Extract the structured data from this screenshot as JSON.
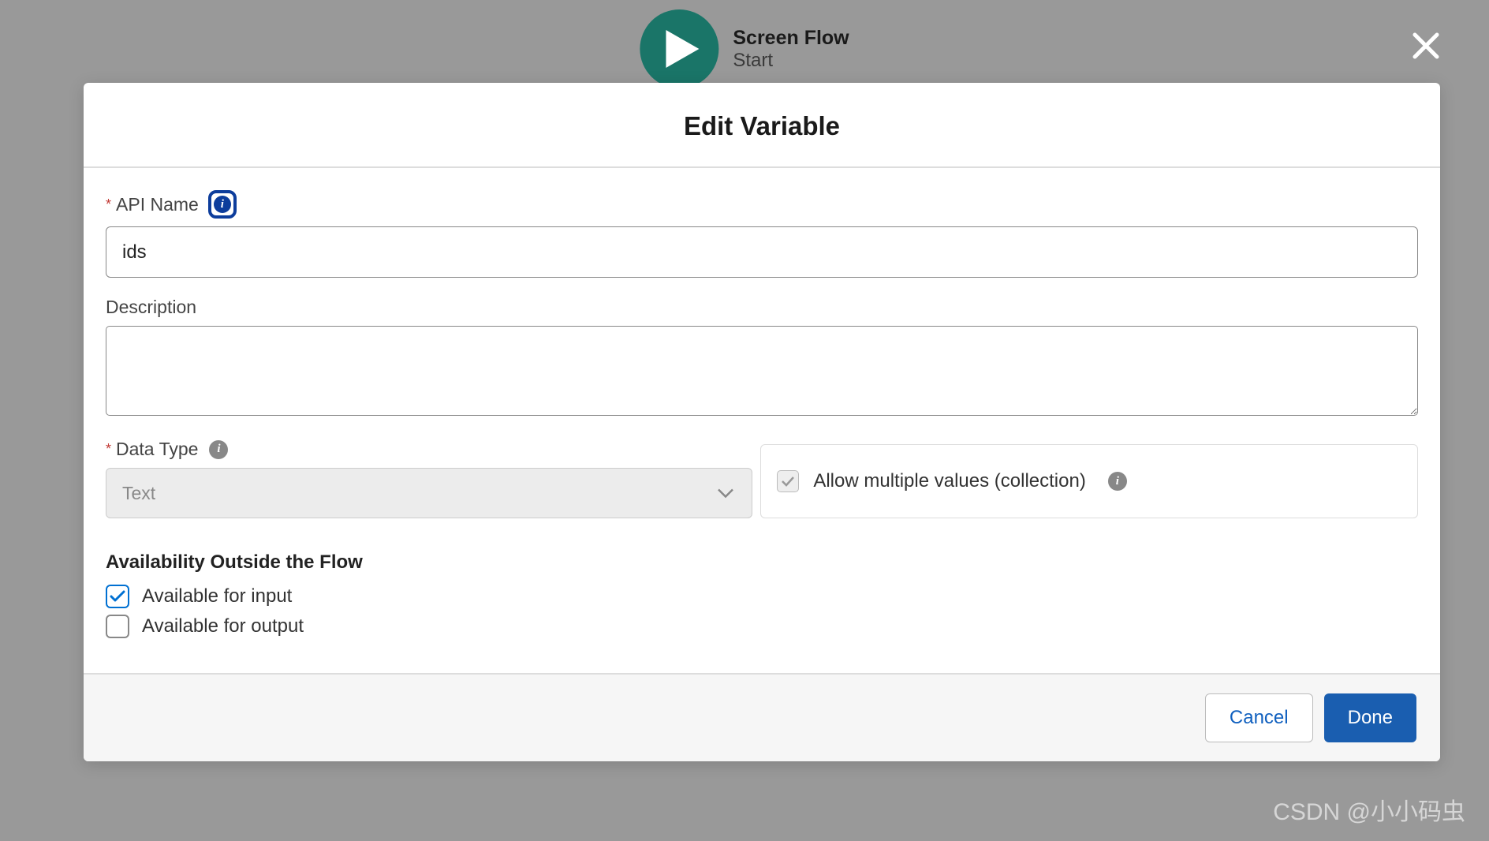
{
  "header": {
    "title": "Screen Flow",
    "subtitle": "Start"
  },
  "modal": {
    "title": "Edit Variable",
    "api_name_label": "API Name",
    "api_name_value": "ids",
    "description_label": "Description",
    "description_value": "",
    "data_type_label": "Data Type",
    "data_type_value": "Text",
    "allow_multiple_label": "Allow multiple values (collection)",
    "section_title": "Availability Outside the Flow",
    "available_input_label": "Available for input",
    "available_output_label": "Available for output",
    "cancel_label": "Cancel",
    "done_label": "Done"
  },
  "watermark": "CSDN @小小码虫"
}
